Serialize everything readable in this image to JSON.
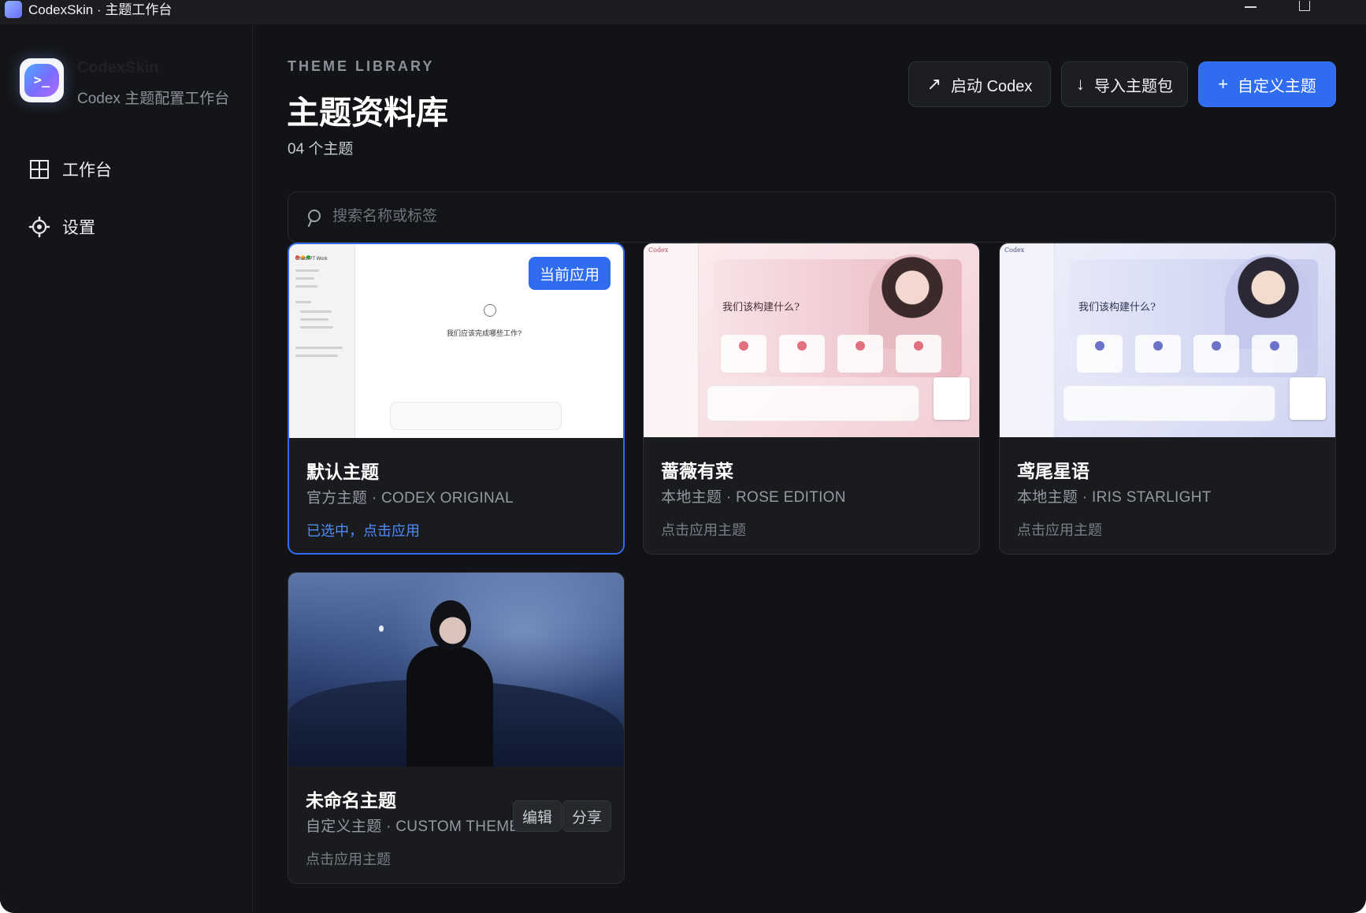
{
  "window": {
    "title": "CodexSkin · 主题工作台"
  },
  "sidebar": {
    "brand_name": "CodexSkin",
    "brand_subtitle": "Codex 主题配置工作台",
    "nav": [
      {
        "label": "工作台",
        "icon": "grid-icon"
      },
      {
        "label": "设置",
        "icon": "gear-icon"
      }
    ]
  },
  "header": {
    "eyebrow": "THEME LIBRARY",
    "title": "主题资料库",
    "count": "04 个主题",
    "buttons": {
      "launch": {
        "label": "启动 Codex",
        "icon": "↗"
      },
      "import": {
        "label": "导入主题包",
        "icon": "↓"
      },
      "custom": {
        "label": "自定义主题",
        "icon": "+"
      }
    }
  },
  "search": {
    "placeholder": "搜索名称或标签",
    "value": ""
  },
  "themes": [
    {
      "title": "默认主题",
      "subtitle": "官方主题 · CODEX ORIGINAL",
      "action": "已选中，点击应用",
      "badge": "当前应用",
      "preview": {
        "app_name": "ChatGPT Work",
        "prompt": "我们应该完成哪些工作?"
      }
    },
    {
      "title": "蔷薇有菜",
      "subtitle": "本地主题 · ROSE EDITION",
      "action": "点击应用主题",
      "preview": {
        "app_name": "Codex",
        "prompt": "我们该构建什么?"
      }
    },
    {
      "title": "鸢尾星语",
      "subtitle": "本地主题 · IRIS STARLIGHT",
      "action": "点击应用主题",
      "preview": {
        "app_name": "Codex",
        "prompt": "我们该构建什么?"
      }
    },
    {
      "title": "未命名主题",
      "subtitle": "自定义主题 · CUSTOM THEME",
      "action": "点击应用主题",
      "edit_label": "编辑",
      "share_label": "分享"
    }
  ],
  "colors": {
    "accent": "#2f6cf0",
    "background": "#121316",
    "card": "#1a1b1f"
  }
}
